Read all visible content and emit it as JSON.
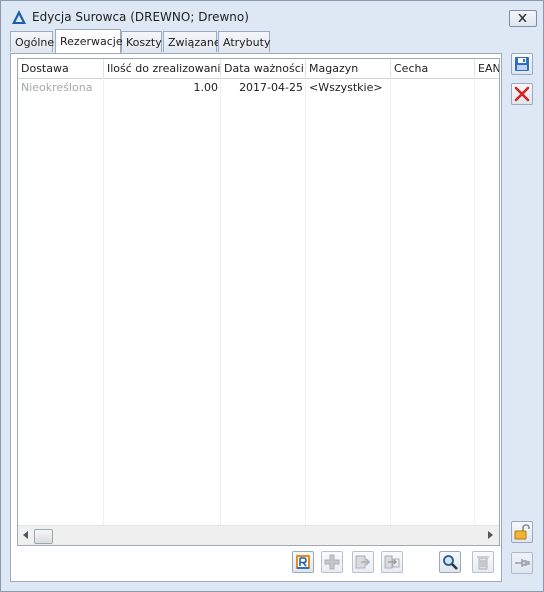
{
  "window": {
    "title": "Edycja Surowca (DREWNO; Drewno)"
  },
  "tabs": [
    {
      "label": "Ogólne"
    },
    {
      "label": "Rezerwacje"
    },
    {
      "label": "Koszty"
    },
    {
      "label": "Związane"
    },
    {
      "label": "Atrybuty"
    }
  ],
  "active_tab": "Rezerwacje",
  "grid": {
    "columns": [
      "Dostawa",
      "Ilość do zrealizowania",
      "Data ważności",
      "Magazyn",
      "Cecha",
      "EAN"
    ],
    "rows": [
      {
        "dostawa": "Nieokreślona",
        "ilosc": "1.00",
        "data": "2017-04-25",
        "magazyn": "<Wszystkie>",
        "cecha": "",
        "ean": ""
      }
    ]
  },
  "colors": {
    "accent": "#1f5fa8",
    "window_bg": "#dde8f4",
    "placeholder_text": "#a8a8a8"
  }
}
